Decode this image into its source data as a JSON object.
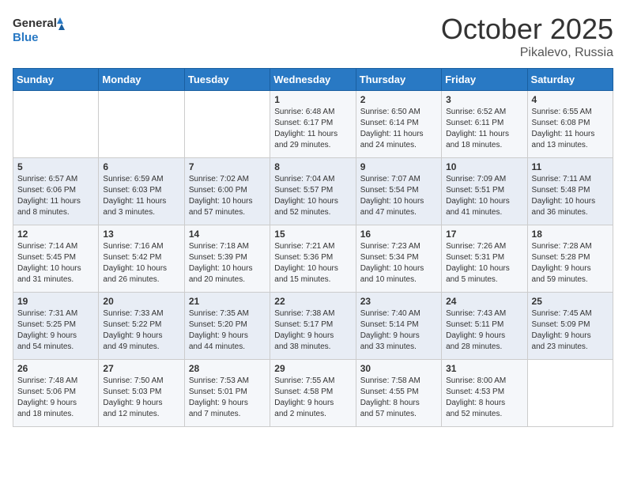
{
  "logo": {
    "line1": "General",
    "line2": "Blue"
  },
  "title": "October 2025",
  "location": "Pikalevo, Russia",
  "headers": [
    "Sunday",
    "Monday",
    "Tuesday",
    "Wednesday",
    "Thursday",
    "Friday",
    "Saturday"
  ],
  "weeks": [
    [
      {
        "day": "",
        "info": ""
      },
      {
        "day": "",
        "info": ""
      },
      {
        "day": "",
        "info": ""
      },
      {
        "day": "1",
        "info": "Sunrise: 6:48 AM\nSunset: 6:17 PM\nDaylight: 11 hours\nand 29 minutes."
      },
      {
        "day": "2",
        "info": "Sunrise: 6:50 AM\nSunset: 6:14 PM\nDaylight: 11 hours\nand 24 minutes."
      },
      {
        "day": "3",
        "info": "Sunrise: 6:52 AM\nSunset: 6:11 PM\nDaylight: 11 hours\nand 18 minutes."
      },
      {
        "day": "4",
        "info": "Sunrise: 6:55 AM\nSunset: 6:08 PM\nDaylight: 11 hours\nand 13 minutes."
      }
    ],
    [
      {
        "day": "5",
        "info": "Sunrise: 6:57 AM\nSunset: 6:06 PM\nDaylight: 11 hours\nand 8 minutes."
      },
      {
        "day": "6",
        "info": "Sunrise: 6:59 AM\nSunset: 6:03 PM\nDaylight: 11 hours\nand 3 minutes."
      },
      {
        "day": "7",
        "info": "Sunrise: 7:02 AM\nSunset: 6:00 PM\nDaylight: 10 hours\nand 57 minutes."
      },
      {
        "day": "8",
        "info": "Sunrise: 7:04 AM\nSunset: 5:57 PM\nDaylight: 10 hours\nand 52 minutes."
      },
      {
        "day": "9",
        "info": "Sunrise: 7:07 AM\nSunset: 5:54 PM\nDaylight: 10 hours\nand 47 minutes."
      },
      {
        "day": "10",
        "info": "Sunrise: 7:09 AM\nSunset: 5:51 PM\nDaylight: 10 hours\nand 41 minutes."
      },
      {
        "day": "11",
        "info": "Sunrise: 7:11 AM\nSunset: 5:48 PM\nDaylight: 10 hours\nand 36 minutes."
      }
    ],
    [
      {
        "day": "12",
        "info": "Sunrise: 7:14 AM\nSunset: 5:45 PM\nDaylight: 10 hours\nand 31 minutes."
      },
      {
        "day": "13",
        "info": "Sunrise: 7:16 AM\nSunset: 5:42 PM\nDaylight: 10 hours\nand 26 minutes."
      },
      {
        "day": "14",
        "info": "Sunrise: 7:18 AM\nSunset: 5:39 PM\nDaylight: 10 hours\nand 20 minutes."
      },
      {
        "day": "15",
        "info": "Sunrise: 7:21 AM\nSunset: 5:36 PM\nDaylight: 10 hours\nand 15 minutes."
      },
      {
        "day": "16",
        "info": "Sunrise: 7:23 AM\nSunset: 5:34 PM\nDaylight: 10 hours\nand 10 minutes."
      },
      {
        "day": "17",
        "info": "Sunrise: 7:26 AM\nSunset: 5:31 PM\nDaylight: 10 hours\nand 5 minutes."
      },
      {
        "day": "18",
        "info": "Sunrise: 7:28 AM\nSunset: 5:28 PM\nDaylight: 9 hours\nand 59 minutes."
      }
    ],
    [
      {
        "day": "19",
        "info": "Sunrise: 7:31 AM\nSunset: 5:25 PM\nDaylight: 9 hours\nand 54 minutes."
      },
      {
        "day": "20",
        "info": "Sunrise: 7:33 AM\nSunset: 5:22 PM\nDaylight: 9 hours\nand 49 minutes."
      },
      {
        "day": "21",
        "info": "Sunrise: 7:35 AM\nSunset: 5:20 PM\nDaylight: 9 hours\nand 44 minutes."
      },
      {
        "day": "22",
        "info": "Sunrise: 7:38 AM\nSunset: 5:17 PM\nDaylight: 9 hours\nand 38 minutes."
      },
      {
        "day": "23",
        "info": "Sunrise: 7:40 AM\nSunset: 5:14 PM\nDaylight: 9 hours\nand 33 minutes."
      },
      {
        "day": "24",
        "info": "Sunrise: 7:43 AM\nSunset: 5:11 PM\nDaylight: 9 hours\nand 28 minutes."
      },
      {
        "day": "25",
        "info": "Sunrise: 7:45 AM\nSunset: 5:09 PM\nDaylight: 9 hours\nand 23 minutes."
      }
    ],
    [
      {
        "day": "26",
        "info": "Sunrise: 7:48 AM\nSunset: 5:06 PM\nDaylight: 9 hours\nand 18 minutes."
      },
      {
        "day": "27",
        "info": "Sunrise: 7:50 AM\nSunset: 5:03 PM\nDaylight: 9 hours\nand 12 minutes."
      },
      {
        "day": "28",
        "info": "Sunrise: 7:53 AM\nSunset: 5:01 PM\nDaylight: 9 hours\nand 7 minutes."
      },
      {
        "day": "29",
        "info": "Sunrise: 7:55 AM\nSunset: 4:58 PM\nDaylight: 9 hours\nand 2 minutes."
      },
      {
        "day": "30",
        "info": "Sunrise: 7:58 AM\nSunset: 4:55 PM\nDaylight: 8 hours\nand 57 minutes."
      },
      {
        "day": "31",
        "info": "Sunrise: 8:00 AM\nSunset: 4:53 PM\nDaylight: 8 hours\nand 52 minutes."
      },
      {
        "day": "",
        "info": ""
      }
    ]
  ]
}
